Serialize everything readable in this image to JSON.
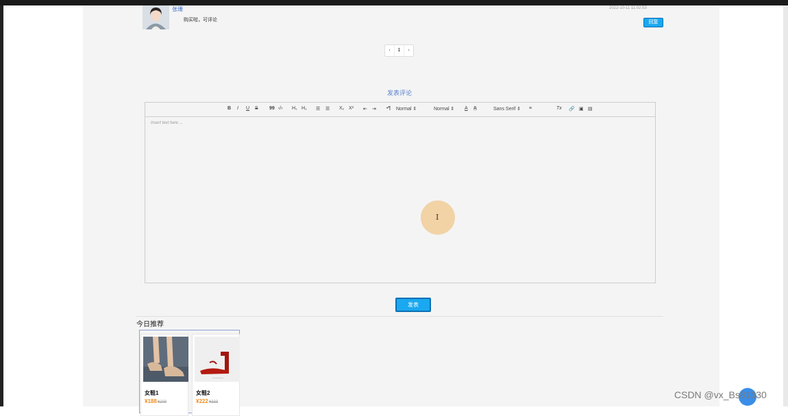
{
  "comment": {
    "username": "张珊",
    "text": "购买啦，可评论",
    "timestamp": "2022-10-11 11:02:53",
    "reply_label": "回复"
  },
  "pagination": {
    "prev": "‹",
    "current": "1",
    "next": "›"
  },
  "editor": {
    "title": "发表评论",
    "placeholder": "Insert text here ...",
    "toolbar": {
      "bold": "B",
      "italic": "I",
      "underline": "U",
      "strike": "S",
      "blockquote": "99",
      "code": "‹/›",
      "h1": "H₁",
      "h2": "H₂",
      "ordered_list": "☰",
      "bullet_list": "☰",
      "sub": "X₂",
      "super": "X²",
      "indent_out": "⇤",
      "indent_in": "⇥",
      "direction": "•¶",
      "size_select": "Normal ⇕",
      "header_select": "Normal ⇕",
      "color": "A",
      "background": "A",
      "font_select": "Sans Serif ⇕",
      "align": "≡",
      "clean": "Tx",
      "link": "🔗",
      "image": "▣",
      "video": "▤"
    },
    "submit_label": "发表"
  },
  "recommend": {
    "title": "今日推荐",
    "products": [
      {
        "name": "女鞋1",
        "price": "¥188",
        "old_price": "¥200"
      },
      {
        "name": "女鞋2",
        "price": "¥222",
        "old_price": "¥333"
      }
    ]
  },
  "watermark": "CSDN @vx_Bs81330",
  "colors": {
    "accent": "#1aa8f0",
    "link": "#3f6fd0",
    "price": "#f08c1a"
  }
}
